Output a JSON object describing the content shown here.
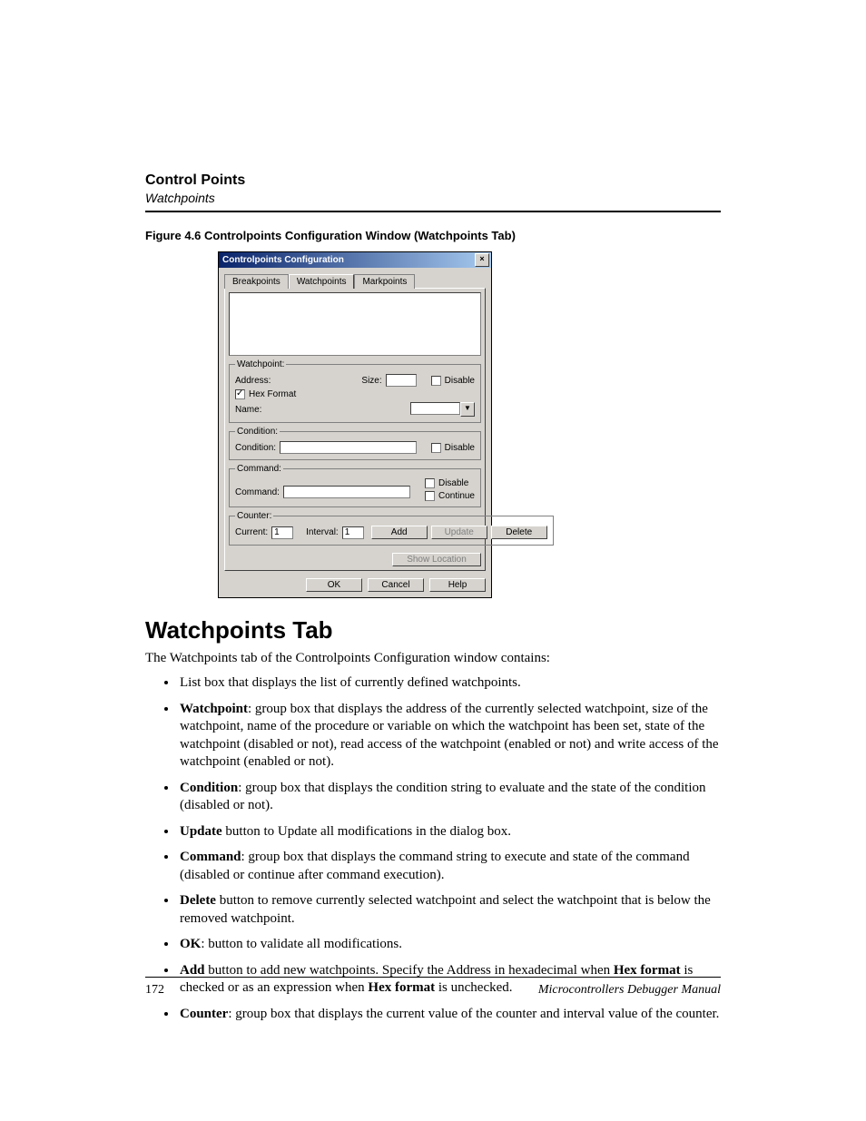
{
  "header": {
    "title": "Control Points",
    "subtitle": "Watchpoints"
  },
  "figure": {
    "caption": "Figure 4.6  Controlpoints Configuration Window (Watchpoints Tab)"
  },
  "dialog": {
    "title": "Controlpoints Configuration",
    "close_glyph": "×",
    "tabs": {
      "breakpoints": "Breakpoints",
      "watchpoints": "Watchpoints",
      "markpoints": "Markpoints"
    },
    "watchpoint_group": {
      "legend": "Watchpoint:",
      "address_label": "Address:",
      "size_label": "Size:",
      "disable_label": "Disable",
      "hexformat_label": "Hex Format",
      "name_label": "Name:"
    },
    "condition_group": {
      "legend": "Condition:",
      "condition_label": "Condition:",
      "disable_label": "Disable"
    },
    "command_group": {
      "legend": "Command:",
      "command_label": "Command:",
      "disable_label": "Disable",
      "continue_label": "Continue"
    },
    "counter_group": {
      "legend": "Counter:",
      "current_label": "Current:",
      "current_value": "1",
      "interval_label": "Interval:",
      "interval_value": "1",
      "add": "Add",
      "update": "Update",
      "delete": "Delete"
    },
    "show_location": "Show Location",
    "ok": "OK",
    "cancel": "Cancel",
    "help": "Help",
    "dd_glyph": "▼"
  },
  "section": {
    "heading": "Watchpoints Tab",
    "intro": "The Watchpoints tab of the Controlpoints Configuration window contains:"
  },
  "bullets": {
    "b0": "List box that displays the list of currently defined watchpoints.",
    "b1_bold": "Watchpoint",
    "b1_rest": ": group box that displays the address of the currently selected watchpoint, size of the watchpoint, name of the procedure or variable on which the watchpoint has been set, state of the watchpoint (disabled or not), read access of the watchpoint (enabled or not) and write access of the watchpoint (enabled or not).",
    "b2_bold": "Condition",
    "b2_rest": ": group box that displays the condition string to evaluate and the state of the condition (disabled or not).",
    "b3_bold": "Update",
    "b3_rest": " button to Update all modifications in the dialog box.",
    "b4_bold": "Command",
    "b4_rest": ": group box that displays the command string to execute and state of the command (disabled or continue after command execution).",
    "b5_bold": "Delete",
    "b5_rest": " button to remove currently selected watchpoint and select the watchpoint that is below the removed watchpoint.",
    "b6_bold": "OK",
    "b6_rest": ": button to validate all modifications.",
    "b7_bold1": "Add",
    "b7_mid1": " button to add new watchpoints. Specify the Address in hexadecimal when ",
    "b7_bold2": "Hex format",
    "b7_mid2": " is checked or as an expression when ",
    "b7_bold3": "Hex format",
    "b7_end": " is unchecked.",
    "b8_bold": "Counter",
    "b8_rest": ": group box that displays the current value of the counter and interval value of the counter."
  },
  "footer": {
    "page": "172",
    "manual": "Microcontrollers Debugger Manual"
  }
}
